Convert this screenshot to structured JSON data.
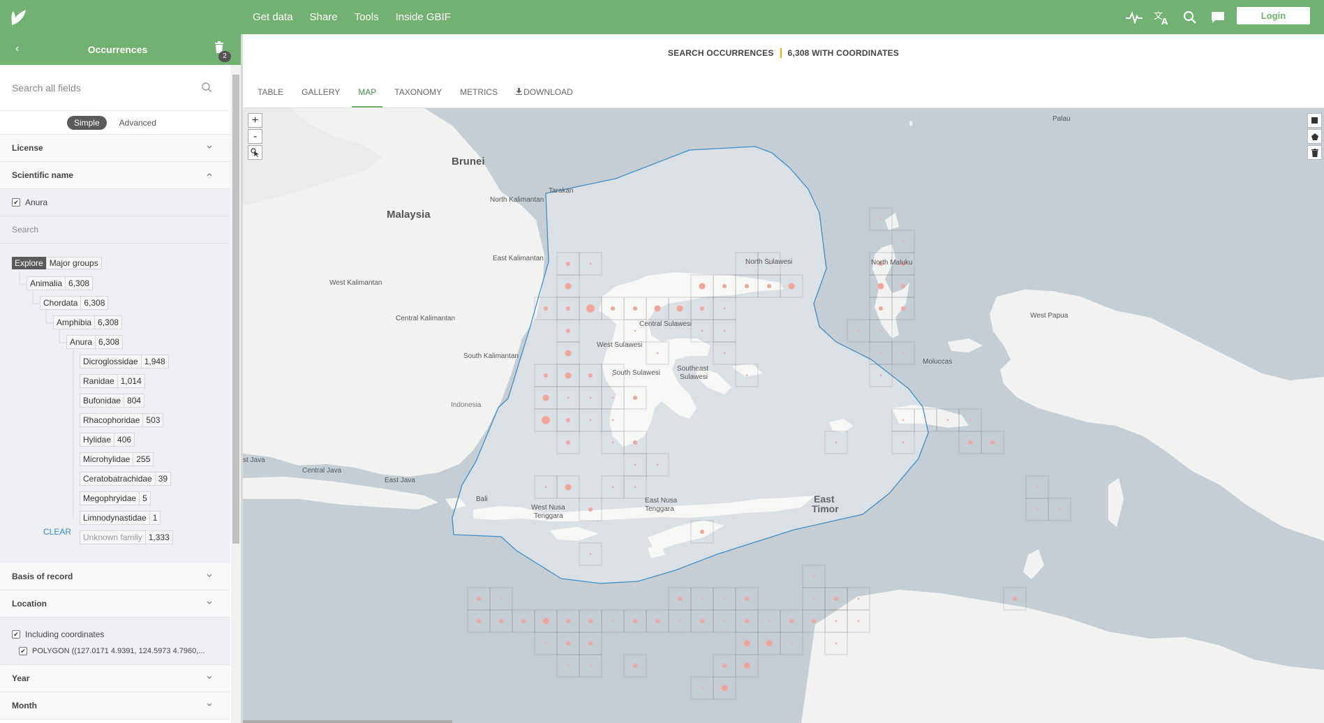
{
  "topbar": {
    "nav": [
      "Get data",
      "Share",
      "Tools",
      "Inside GBIF"
    ],
    "login": "Login",
    "icons": [
      "leaf-logo-icon",
      "activity-icon",
      "translate-icon",
      "search-icon",
      "feedback-icon"
    ]
  },
  "sidebar": {
    "title": "Occurrences",
    "badge": "2",
    "search_placeholder": "Search all fields",
    "modes": [
      "Simple",
      "Advanced"
    ],
    "facets": {
      "license": "License",
      "scientific_name": "Scientific name",
      "scientific_value": "Anura",
      "search_label": "Search",
      "explore": "Explore",
      "major_groups": "Major groups",
      "clear": "CLEAR",
      "basis": "Basis of record",
      "location": "Location",
      "including_coords": "Including coordinates",
      "polygon": "POLYGON ((127.0171 4.9391, 124.5973 4.7960,...",
      "year": "Year",
      "month": "Month"
    },
    "tree": [
      {
        "name": "Animalia",
        "count": "6,308"
      },
      {
        "name": "Chordata",
        "count": "6,308"
      },
      {
        "name": "Amphibia",
        "count": "6,308"
      },
      {
        "name": "Anura",
        "count": "6,308"
      },
      {
        "name": "Dicroglossidae",
        "count": "1,948"
      },
      {
        "name": "Ranidae",
        "count": "1,014"
      },
      {
        "name": "Bufonidae",
        "count": "804"
      },
      {
        "name": "Rhacophoridae",
        "count": "503"
      },
      {
        "name": "Hylidae",
        "count": "406"
      },
      {
        "name": "Microhylidae",
        "count": "255"
      },
      {
        "name": "Ceratobatrachidae",
        "count": "39"
      },
      {
        "name": "Megophryidae",
        "count": "5"
      },
      {
        "name": "Limnodynastidae",
        "count": "1"
      },
      {
        "name": "Unknown family",
        "count": "1,333"
      }
    ]
  },
  "main": {
    "summary_left": "SEARCH OCCURRENCES",
    "summary_right": "6,308 WITH COORDINATES",
    "tabs": [
      "TABLE",
      "GALLERY",
      "MAP",
      "TAXONOMY",
      "METRICS",
      "DOWNLOAD"
    ],
    "active_tab": "MAP",
    "map_controls": [
      "+",
      "-"
    ],
    "map_labels": {
      "brunei": "Brunei",
      "malaysia": "Malaysia",
      "tarakan": "Tarakan",
      "north_kalimantan": "North Kalimantan",
      "east_kalimantan": "East Kalimantan",
      "west_kalimantan": "West Kalimantan",
      "central_kalimantan": "Central Kalimantan",
      "south_kalimantan": "South Kalimantan",
      "indonesia": "Indonesia",
      "north_sulawesi": "North Sulawesi",
      "central_sulawesi": "Central Sulawesi",
      "west_sulawesi": "West Sulawesi",
      "southeast_sulawesi_1": "Southeast",
      "southeast_sulawesi_2": "Sulawesi",
      "south_sulawesi": "South Sulawesi",
      "north_maluku": "North Maluku",
      "moluccas": "Moluccas",
      "west_papua": "West Papua",
      "palau": "Palau",
      "central_java": "Central Java",
      "east_java": "East Java",
      "west_java_partial": "st Java",
      "bali": "Bali",
      "west_nusa_1": "West Nusa",
      "west_nusa_2": "Tenggara",
      "east_nusa_1": "East Nusa",
      "east_nusa_2": "Tenggara",
      "east_timor_1": "East",
      "east_timor_2": "Timor"
    }
  }
}
